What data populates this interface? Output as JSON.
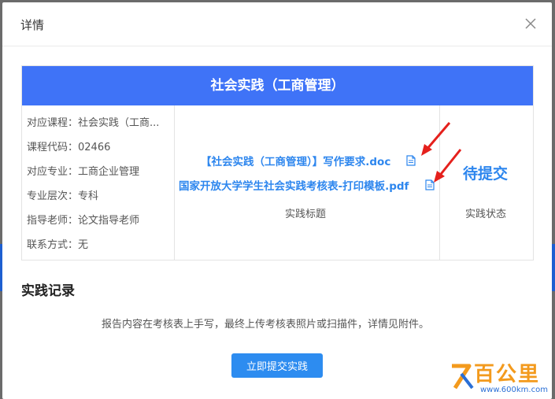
{
  "dialog": {
    "title": "详情"
  },
  "course": {
    "name": "社会实践（工商管理）",
    "info": [
      "对应课程：社会实践（工商...",
      "课程代码：02466",
      "对应专业：工商企业管理",
      "专业层次：专科",
      "指导老师：论文指导老师",
      "联系方式：无"
    ],
    "files": [
      "【社会实践（工商管理）】写作要求.doc",
      "国家开放大学学生社会实践考核表-打印模板.pdf"
    ],
    "files_caption": "实践标题",
    "status": "待提交",
    "status_caption": "实践状态"
  },
  "records": {
    "title": "实践记录",
    "note": "报告内容在考核表上手写，最终上传考核表照片或扫描件，详情见附件。",
    "submit_label": "立即提交实践"
  },
  "watermark": {
    "main": "百公里",
    "sub": "www.600km.com"
  },
  "colors": {
    "header_blue": "#3f73f7",
    "link_blue": "#2d86ee",
    "button_blue": "#2d8cf0",
    "arrow_red": "#e5201c"
  }
}
